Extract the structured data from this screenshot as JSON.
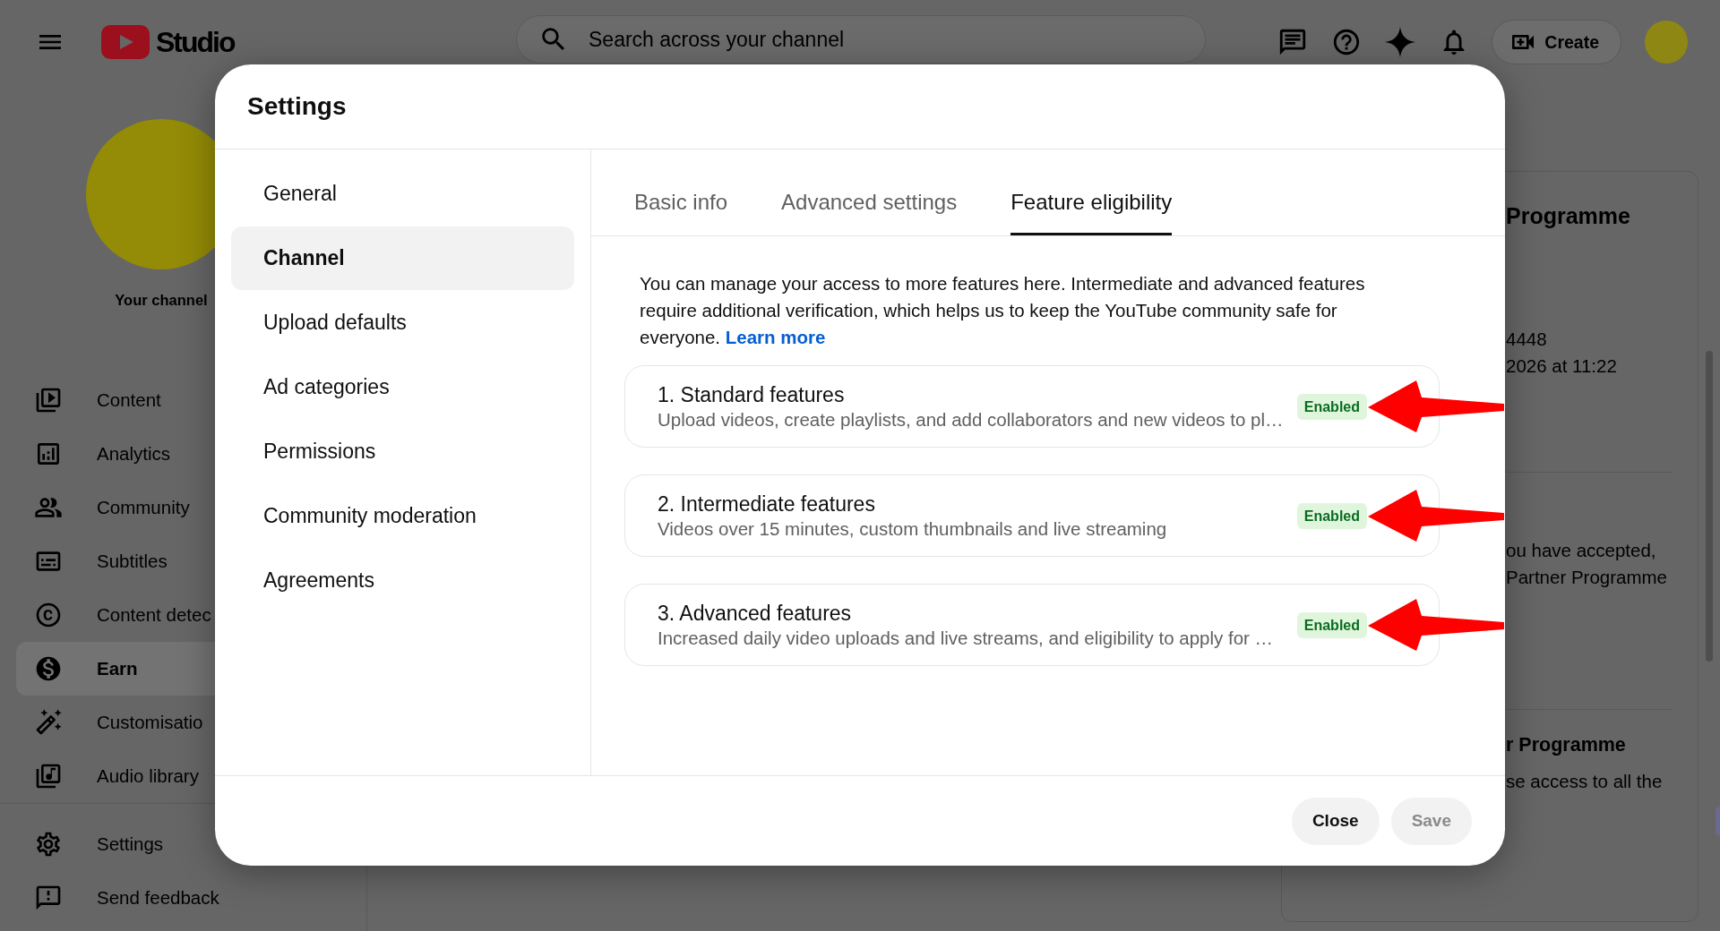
{
  "top_bar": {
    "logo_text": "Studio",
    "search": {
      "placeholder": "Search across your channel"
    },
    "create_button": "Create"
  },
  "sidebar": {
    "channel_label": "Your channel",
    "items": [
      {
        "label": "Content",
        "selected": false
      },
      {
        "label": "Analytics",
        "selected": false
      },
      {
        "label": "Community",
        "selected": false
      },
      {
        "label": "Subtitles",
        "selected": false
      },
      {
        "label": "Content detec",
        "selected": false
      },
      {
        "label": "Earn",
        "selected": true
      },
      {
        "label": "Customisatio",
        "selected": false
      },
      {
        "label": "Audio library",
        "selected": false
      }
    ],
    "footer_items": [
      {
        "label": "Settings",
        "selected": false
      },
      {
        "label": "Send feedback",
        "selected": false
      }
    ]
  },
  "background_panel": {
    "title": "Programme",
    "details": [
      "4448",
      "2026 at 11:22"
    ],
    "note_lines": [
      "ou have accepted,",
      "Partner Programme"
    ],
    "section_title": "r Programme",
    "section_lines": [
      "se access to all the"
    ]
  },
  "dialog": {
    "title": "Settings",
    "nav": [
      {
        "label": "General",
        "selected": false
      },
      {
        "label": "Channel",
        "selected": true
      },
      {
        "label": "Upload defaults",
        "selected": false
      },
      {
        "label": "Ad categories",
        "selected": false
      },
      {
        "label": "Permissions",
        "selected": false
      },
      {
        "label": "Community moderation",
        "selected": false
      },
      {
        "label": "Agreements",
        "selected": false
      }
    ],
    "tabs": [
      {
        "label": "Basic info",
        "selected": false
      },
      {
        "label": "Advanced settings",
        "selected": false
      },
      {
        "label": "Feature eligibility",
        "selected": true
      }
    ],
    "intro": "You can manage your access to more features here. Intermediate and advanced features require additional verification, which helps us to keep the YouTube community safe for everyone.",
    "intro_link": "Learn more",
    "features": [
      {
        "title": "1. Standard features",
        "description": "Upload videos, create playlists, and add collaborators and new videos to pl…",
        "badge": "Enabled",
        "arrow": true
      },
      {
        "title": "2. Intermediate features",
        "description": "Videos over 15 minutes, custom thumbnails and live streaming",
        "badge": "Enabled",
        "arrow": true
      },
      {
        "title": "3. Advanced features",
        "description": "Increased daily video uploads and live streams, and eligibility to apply for …",
        "badge": "Enabled",
        "arrow": true
      }
    ],
    "buttons": [
      {
        "label": "Close",
        "disabled": false
      },
      {
        "label": "Save",
        "disabled": true
      }
    ]
  }
}
